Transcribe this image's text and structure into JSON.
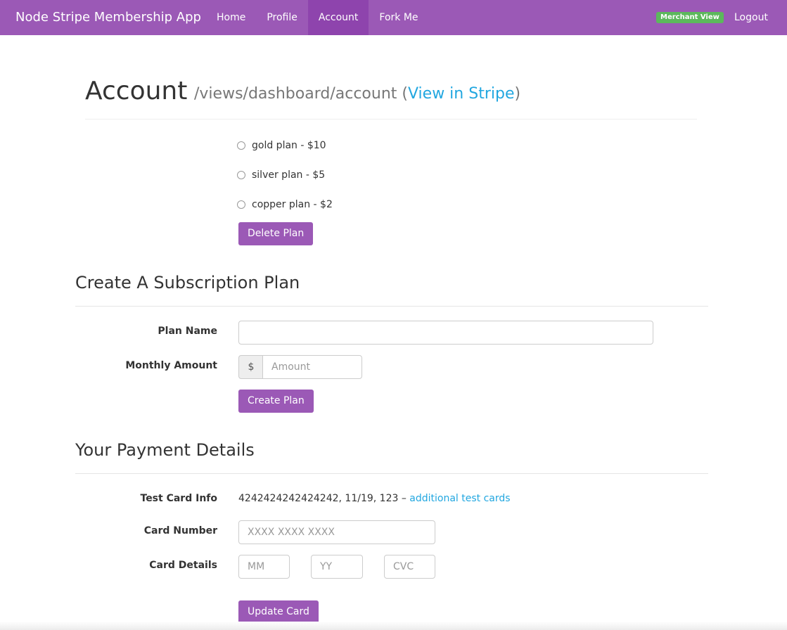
{
  "navbar": {
    "brand": "Node Stripe Membership App",
    "links": [
      "Home",
      "Profile",
      "Account",
      "Fork Me"
    ],
    "badge": "Merchant View",
    "logout": "Logout",
    "color": "#9b59b6",
    "active_color": "#8e44ad"
  },
  "header": {
    "title": "Account",
    "path": "/views/dashboard/account",
    "open_paren": "(",
    "stripe_link": "View in Stripe",
    "close_paren": ")"
  },
  "plans": {
    "options": [
      "gold plan - $10",
      "silver plan - $5",
      "copper plan - $2"
    ],
    "delete_button": "Delete Plan"
  },
  "create_plan": {
    "title": "Create A Subscription Plan",
    "plan_name_label": "Plan Name",
    "plan_name_value": "",
    "monthly_amount_label": "Monthly Amount",
    "currency_addon": "$",
    "amount_placeholder": "Amount",
    "create_button": "Create Plan"
  },
  "payment": {
    "title": "Your Payment Details",
    "test_card_label": "Test Card Info",
    "test_card_text": "4242424242424242, 11/19, 123 – ",
    "test_cards_link": "additional test cards",
    "card_number_label": "Card Number",
    "card_number_placeholder": "XXXX XXXX XXXX",
    "card_details_label": "Card Details",
    "mm_placeholder": "MM",
    "yy_placeholder": "YY",
    "cvc_placeholder": "CVC",
    "update_button": "Update Card"
  },
  "colors": {
    "primary": "#9b59b6",
    "link": "#22a7e0",
    "badge": "#5cb85c"
  }
}
